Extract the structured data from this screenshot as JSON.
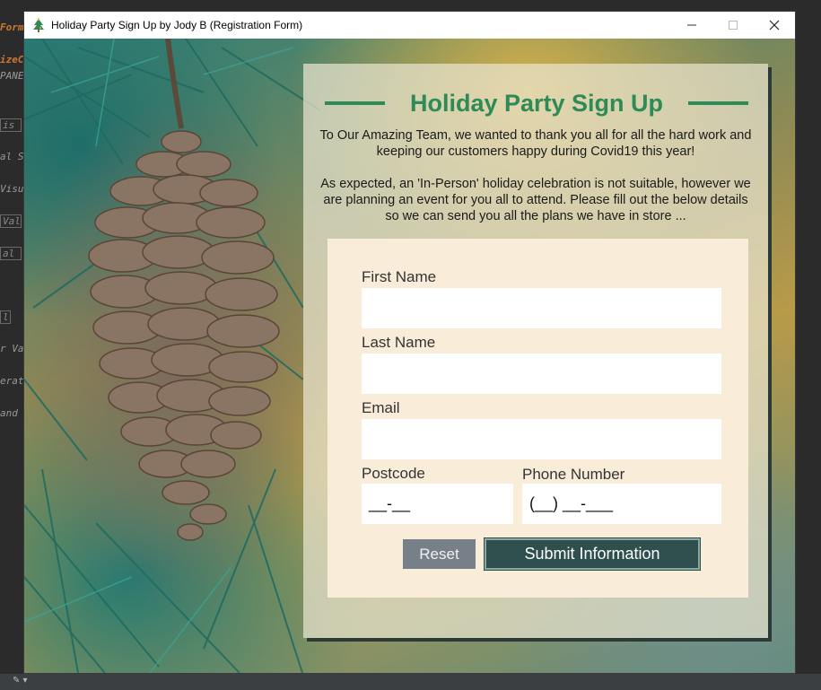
{
  "window": {
    "title": "Holiday Party Sign Up by Jody B (Registration Form)"
  },
  "ide": {
    "snippets": [
      "Form",
      "izeC",
      "PANE",
      "is",
      "al S",
      "Visu",
      "Val",
      "al",
      "l",
      "r Va",
      "erat",
      "and"
    ]
  },
  "panel": {
    "heading": "Holiday Party Sign Up",
    "intro_p1": "To Our Amazing Team, we wanted to thank you all for all the hard work and keeping our customers happy during Covid19 this year!",
    "intro_p2": "As expected, an 'In-Person' holiday celebration is not suitable, however we are planning an event for you all to attend. Please fill out the below details so we can send you all the plans we have in store ..."
  },
  "form": {
    "first_name_label": "First Name",
    "first_name_value": "",
    "last_name_label": "Last Name",
    "last_name_value": "",
    "email_label": "Email",
    "email_value": "",
    "postcode_label": "Postcode",
    "postcode_mask": "__-__",
    "phone_label": "Phone Number",
    "phone_mask": "(__) __-___",
    "reset_label": "Reset",
    "submit_label": "Submit Information"
  },
  "colors": {
    "accent": "#2e8b57",
    "form_bg": "#f9ecd9",
    "submit_bg": "#2f4f4f",
    "reset_bg": "#778088"
  }
}
